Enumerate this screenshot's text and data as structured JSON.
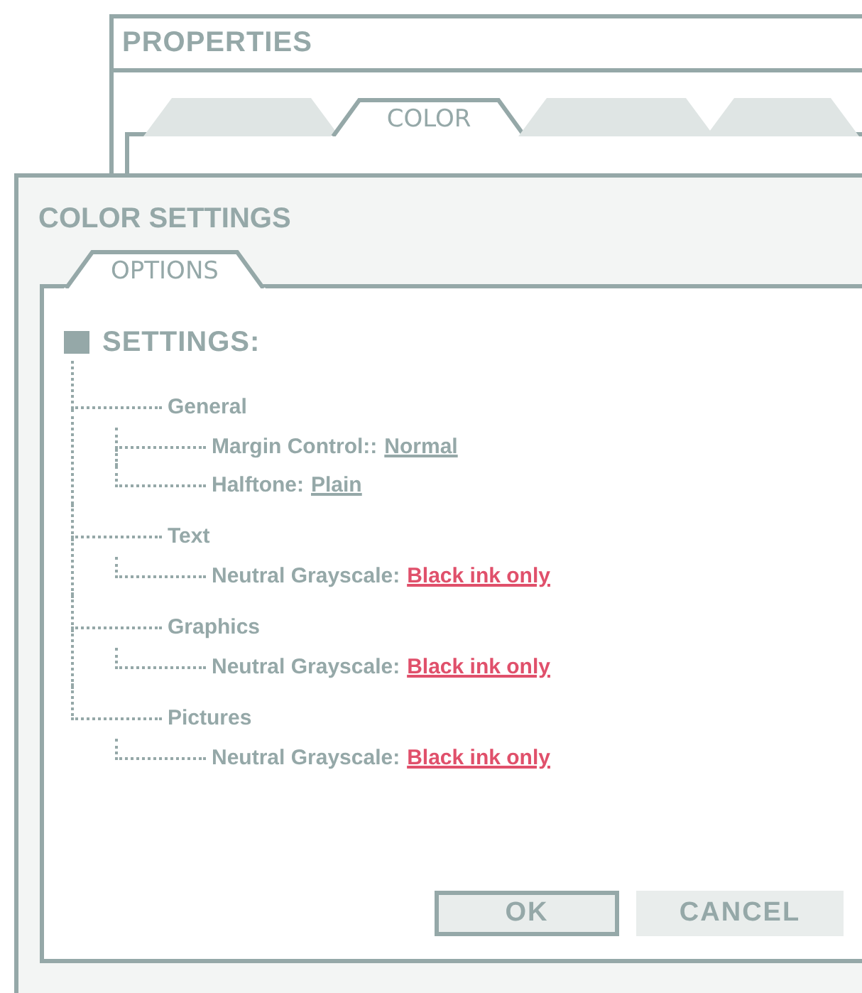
{
  "back_window": {
    "title": "PROPERTIES",
    "tabs": [
      {
        "selected": false
      },
      {
        "label": "COLOR",
        "selected": true
      },
      {
        "selected": false
      },
      {
        "selected": false
      }
    ]
  },
  "dialog": {
    "title": "COLOR SETTINGS",
    "tabs": [
      {
        "label": "OPTIONS",
        "selected": true
      }
    ],
    "tree": {
      "label": "SETTINGS:",
      "children": [
        {
          "label": "General",
          "children": [
            {
              "label": "Margin Control::",
              "value": "Normal",
              "color": "#95a8a8"
            },
            {
              "label": "Halftone:",
              "value": "Plain",
              "color": "#95a8a8"
            }
          ]
        },
        {
          "label": "Text",
          "children": [
            {
              "label": "Neutral Grayscale:",
              "value": "Black ink only",
              "color": "#e0506b"
            }
          ]
        },
        {
          "label": "Graphics",
          "children": [
            {
              "label": "Neutral Grayscale:",
              "value": "Black ink only",
              "color": "#e0506b"
            }
          ]
        },
        {
          "label": "Pictures",
          "children": [
            {
              "label": "Neutral Grayscale:",
              "value": "Black ink only",
              "color": "#e0506b"
            }
          ]
        }
      ]
    },
    "buttons": [
      {
        "label": "OK",
        "kind": "primary"
      },
      {
        "label": "CANCEL",
        "kind": "secondary"
      }
    ]
  }
}
